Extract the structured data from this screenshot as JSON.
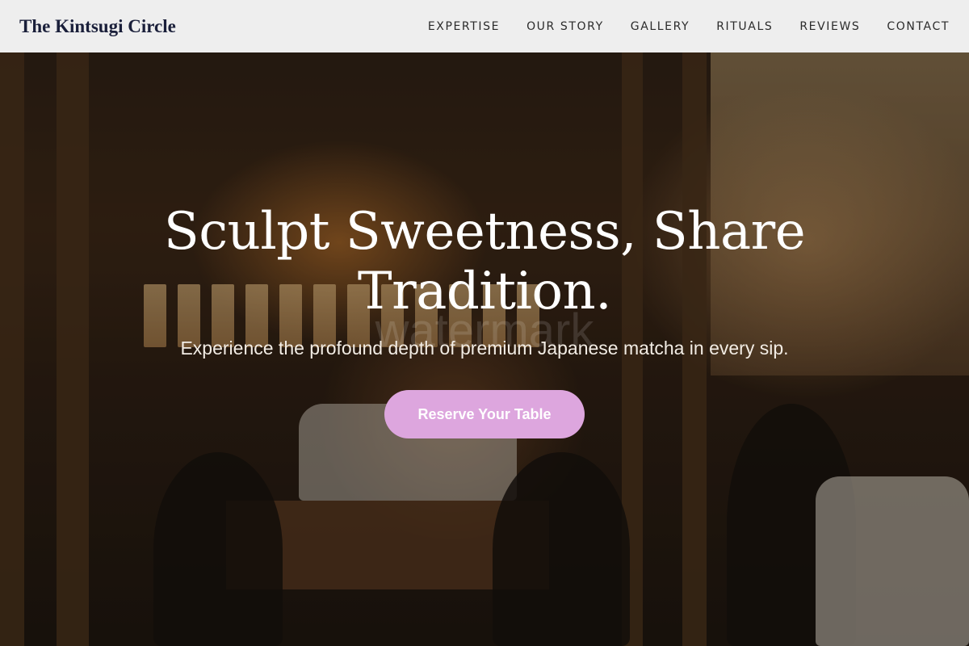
{
  "header": {
    "brand": "The Kintsugi Circle",
    "nav": [
      {
        "label": "EXPERTISE"
      },
      {
        "label": "OUR STORY"
      },
      {
        "label": "GALLERY"
      },
      {
        "label": "RITUALS"
      },
      {
        "label": "REVIEWS"
      },
      {
        "label": "CONTACT"
      }
    ]
  },
  "hero": {
    "headline": "Sculpt Sweetness, Share Tradition.",
    "subtitle": "Experience the profound depth of premium Japanese matcha in every sip.",
    "cta_label": "Reserve Your Table",
    "watermark": "watermark"
  },
  "colors": {
    "nav_background": "#eeeeee",
    "brand_text": "#1a1f3a",
    "cta_background": "#dda6de",
    "hero_text": "#ffffff"
  }
}
